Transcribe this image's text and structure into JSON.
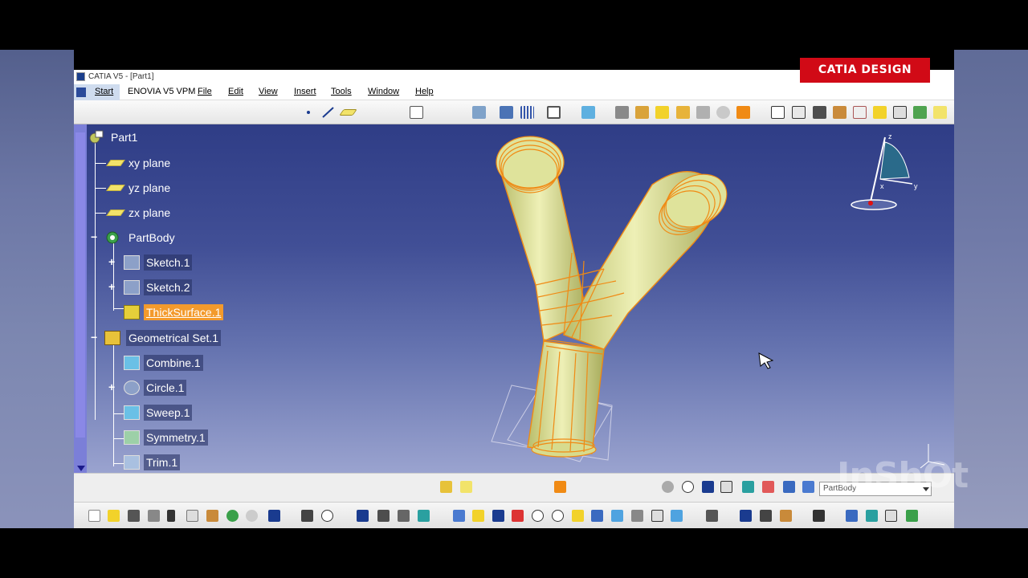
{
  "window": {
    "title": "CATIA V5 - [Part1]"
  },
  "menubar": {
    "start": "Start",
    "items": [
      "ENOVIA V5 VPM",
      "File",
      "Edit",
      "View",
      "Insert",
      "Tools",
      "Window",
      "Help"
    ]
  },
  "tree": {
    "root": "Part1",
    "nodes": [
      {
        "label": "xy plane"
      },
      {
        "label": "yz plane"
      },
      {
        "label": "zx plane"
      },
      {
        "label": "PartBody"
      },
      {
        "label": "Sketch.1"
      },
      {
        "label": "Sketch.2"
      },
      {
        "label": "ThickSurface.1"
      },
      {
        "label": "Geometrical Set.1"
      },
      {
        "label": "Combine.1"
      },
      {
        "label": "Circle.1"
      },
      {
        "label": "Sweep.1"
      },
      {
        "label": "Symmetry.1"
      },
      {
        "label": "Trim.1"
      }
    ]
  },
  "compass": {
    "z": "z",
    "y": "y",
    "x": "x"
  },
  "toolbar_mid": {
    "combo_value": "PartBody"
  },
  "overlay": {
    "badge": "CATIA DESIGN",
    "watermark": "InShOt"
  },
  "colors": {
    "badge": "#d10a16",
    "selection": "#f39a2c",
    "model_fill": "#d8dc8c",
    "model_edges": "#f08a14",
    "background_top": "#2f3d86",
    "background_bottom": "#9aa3cf"
  }
}
